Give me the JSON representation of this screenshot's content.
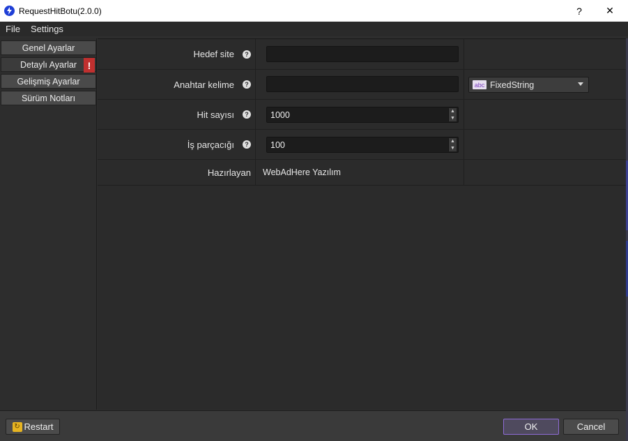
{
  "window": {
    "title": "RequestHitBotu(2.0.0)",
    "help_glyph": "?",
    "close_glyph": "✕"
  },
  "menu": {
    "items": [
      "File",
      "Settings"
    ]
  },
  "sidebar": {
    "items": [
      {
        "label": "Genel Ayarlar"
      },
      {
        "label": "Detaylı Ayarlar",
        "warning": "!"
      },
      {
        "label": "Gelişmiş Ayarlar"
      },
      {
        "label": "Sürüm Notları"
      }
    ]
  },
  "form": {
    "hedef_site": {
      "label": "Hedef site",
      "value": ""
    },
    "anahtar_kelime": {
      "label": "Anahtar kelime",
      "value": "",
      "mode_icon": "abc",
      "mode": "FixedString"
    },
    "hit_sayisi": {
      "label": "Hit sayısı",
      "value": "1000"
    },
    "is_parcacigi": {
      "label": "İş parçacığı",
      "value": "100"
    },
    "hazirlayan": {
      "label": "Hazırlayan",
      "value": "WebAdHere Yazılım"
    }
  },
  "icons": {
    "help": "?",
    "spin_up": "▲",
    "spin_down": "▼",
    "restart": "↻"
  },
  "footer": {
    "restart_label": "Restart",
    "ok_label": "OK",
    "cancel_label": "Cancel"
  },
  "colors": {
    "background": "#2e2e2e",
    "warning": "#c0302f",
    "ok_border": "#8e6bd6",
    "app_icon": "#1f3fd6"
  }
}
